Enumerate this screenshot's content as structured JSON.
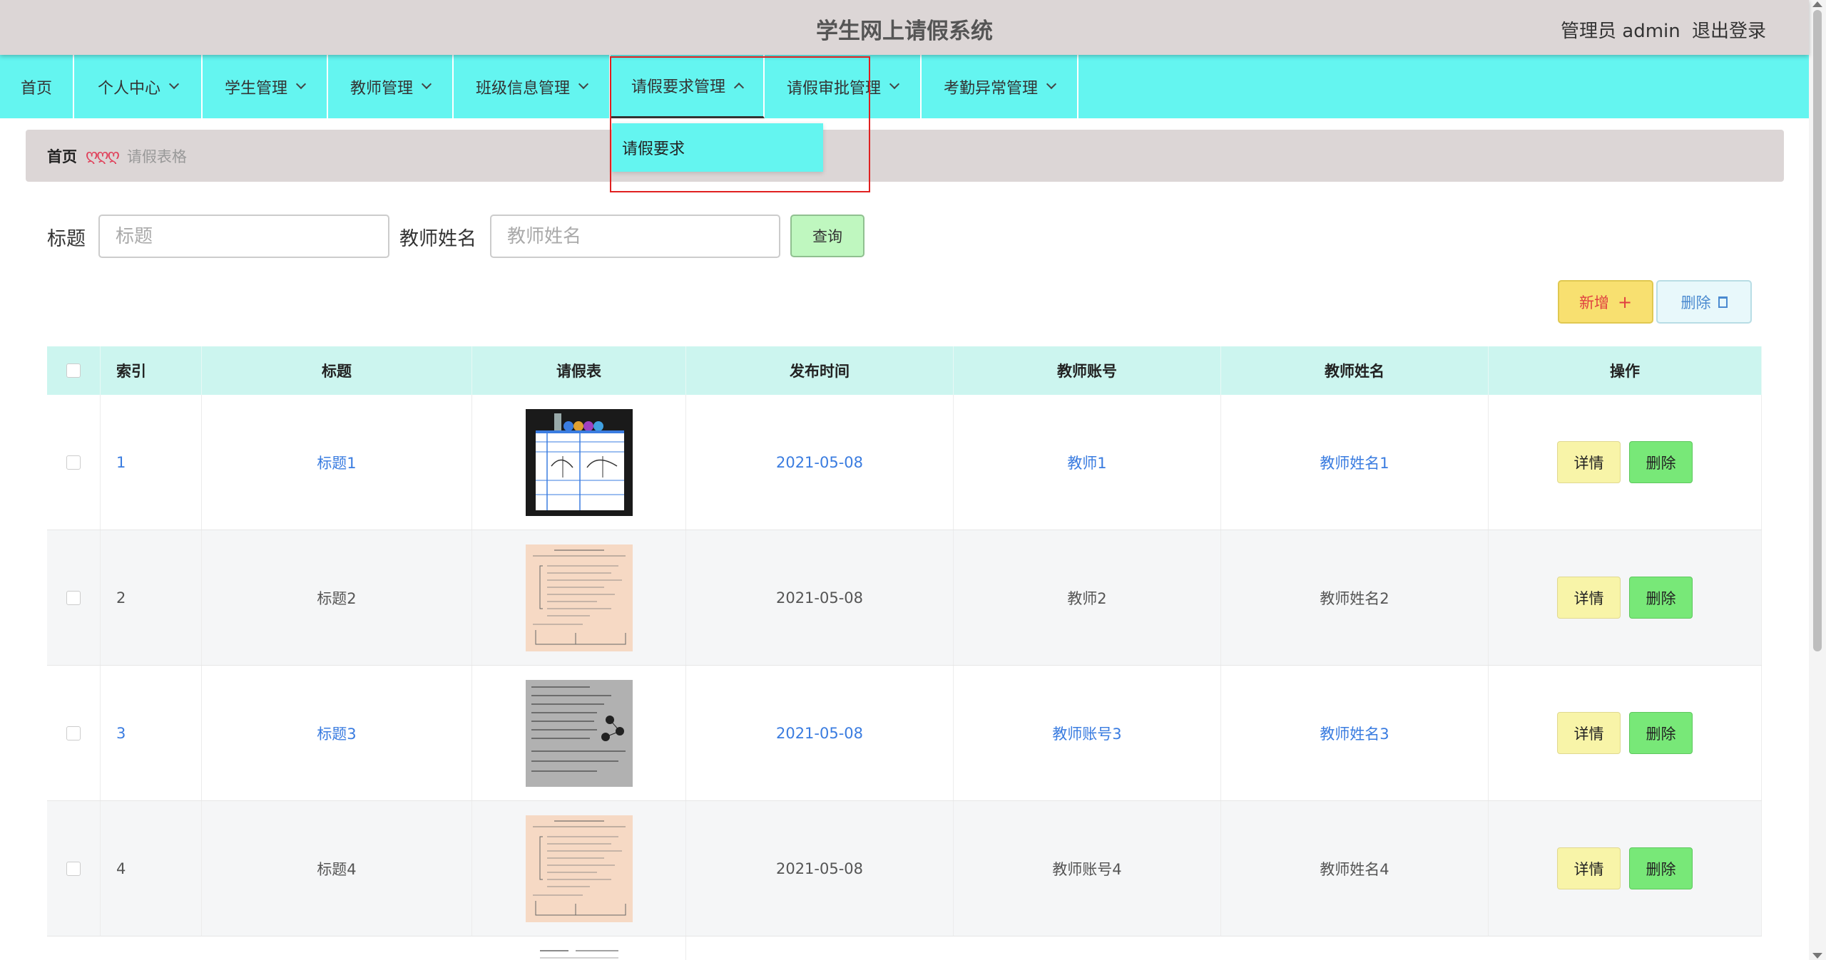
{
  "header": {
    "title": "学生网上请假系统",
    "admin_label": "管理员 admin",
    "logout_label": "退出登录"
  },
  "nav": {
    "items": [
      {
        "label": "首页"
      },
      {
        "label": "个人中心"
      },
      {
        "label": "学生管理"
      },
      {
        "label": "教师管理"
      },
      {
        "label": "班级信息管理"
      },
      {
        "label": "请假要求管理"
      },
      {
        "label": "请假审批管理"
      },
      {
        "label": "考勤异常管理"
      }
    ],
    "dropdown_item": "请假要求"
  },
  "breadcrumb": {
    "home": "首页",
    "separator": "ღღღ",
    "current": "请假表格"
  },
  "search": {
    "title_label": "标题",
    "title_placeholder": "标题",
    "teacher_label": "教师姓名",
    "teacher_placeholder": "教师姓名",
    "query_label": "查询"
  },
  "actions": {
    "add_label": "新增",
    "delete_label": "删除"
  },
  "table": {
    "headers": [
      "索引",
      "标题",
      "请假表",
      "发布时间",
      "教师账号",
      "教师姓名",
      "操作"
    ],
    "rows": [
      {
        "index": "1",
        "title": "标题1",
        "date": "2021-05-08",
        "account": "教师1",
        "name": "教师姓名1",
        "image": "chart-photo"
      },
      {
        "index": "2",
        "title": "标题2",
        "date": "2021-05-08",
        "account": "教师2",
        "name": "教师姓名2",
        "image": "document-beige"
      },
      {
        "index": "3",
        "title": "标题3",
        "date": "2021-05-08",
        "account": "教师账号3",
        "name": "教师姓名3",
        "image": "handwritten-gray"
      },
      {
        "index": "4",
        "title": "标题4",
        "date": "2021-05-08",
        "account": "教师账号4",
        "name": "教师姓名4",
        "image": "document-beige"
      }
    ],
    "detail_label": "详情",
    "row_delete_label": "删除"
  },
  "colors": {
    "nav_bg": "#64f5f0",
    "header_bg": "#dcd6d6",
    "link": "#3a7ce0",
    "add_btn": "#f8e070",
    "row_delete_btn": "#78e878",
    "detail_btn": "#f8f4a8",
    "table_head": "#ccf5ef",
    "highlight": "#e02020"
  }
}
